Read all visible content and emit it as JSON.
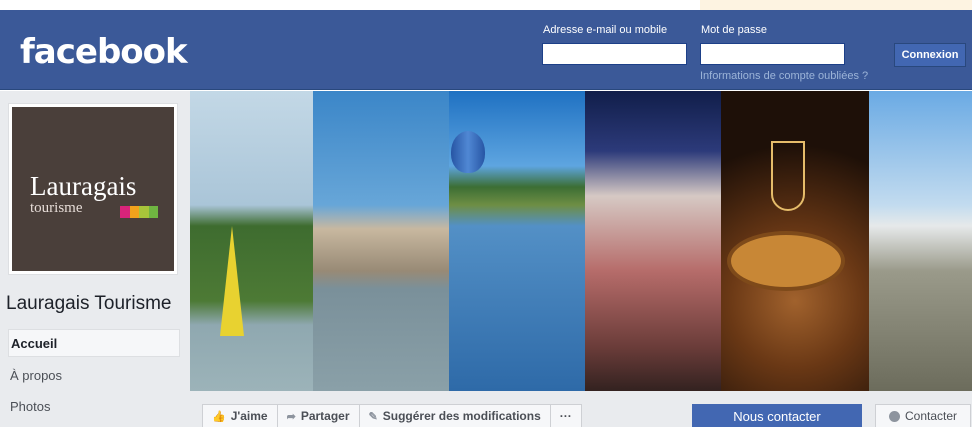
{
  "header": {
    "logo": "facebook",
    "email_label": "Adresse e-mail ou mobile",
    "password_label": "Mot de passe",
    "forgot_link": "Informations de compte oubliées ?",
    "login_button": "Connexion"
  },
  "profile": {
    "logo_title": "Lauragais",
    "logo_subtitle": "tourisme",
    "page_name": "Lauragais Tourisme"
  },
  "nav": [
    {
      "label": "Accueil",
      "active": true
    },
    {
      "label": "À propos"
    },
    {
      "label": "Photos"
    }
  ],
  "actions": {
    "like": "J'aime",
    "share": "Partager",
    "suggest": "Suggérer des modifications",
    "more": "···",
    "contact_primary": "Nous contacter",
    "contact_secondary": "Contacter"
  },
  "colors": {
    "brand": "#3b5998",
    "button_blue": "#4267b2",
    "stripes": [
      "#d8247a",
      "#f1a21c",
      "#a8c43a",
      "#6fb541"
    ]
  }
}
